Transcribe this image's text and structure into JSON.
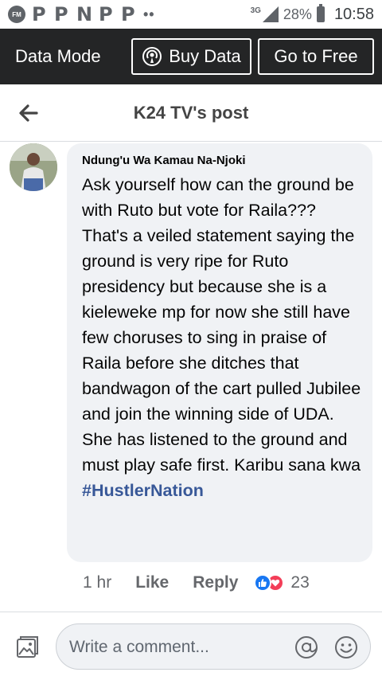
{
  "status_bar": {
    "fm_label": "FM",
    "p_icons": [
      "P",
      "P",
      "N",
      "P",
      "P"
    ],
    "dots": "••",
    "network": "3G",
    "battery": "28%",
    "time": "10:58"
  },
  "data_bar": {
    "title": "Data Mode",
    "buy_label": "Buy Data",
    "free_label": "Go to Free"
  },
  "header": {
    "title": "K24 TV's post"
  },
  "comment": {
    "author": "Ndung'u Wa Kamau Na-Njoki",
    "text": "Ask yourself how can the ground be with Ruto but vote for Raila??? That's a veiled statement saying the ground is very ripe for Ruto presidency but because she is a kieleweke mp for now she still have few choruses to sing in praise of Raila before she ditches that bandwagon of the cart pulled Jubilee and join the winning side of UDA. She has listened to the ground and must play safe first. Karibu sana kwa",
    "hashtag": "#HustlerNation",
    "time_ago": "1 hr",
    "like_label": "Like",
    "reply_label": "Reply",
    "reaction_count": "23",
    "reactions": [
      "like-reaction-icon",
      "love-reaction-icon"
    ]
  },
  "composer": {
    "placeholder": "Write a comment..."
  },
  "colors": {
    "data_bar_bg": "#242526",
    "bubble_bg": "#f0f2f5",
    "hashtag": "#385898",
    "like_blue": "#1877f2",
    "love_red": "#f33e58"
  }
}
